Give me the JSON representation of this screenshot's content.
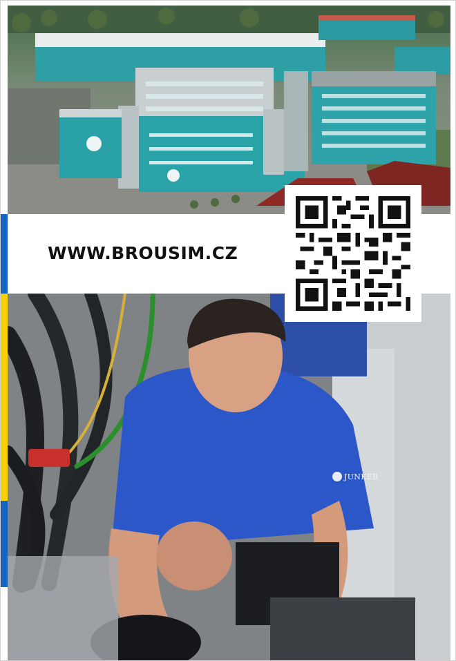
{
  "banner": {
    "url": "WWW.BROUSIM.CZ"
  },
  "shirt": {
    "brand": "JUNKER"
  },
  "icons": {
    "qr": "qr-code-icon",
    "building_logo": "junker-logo-icon"
  },
  "colors": {
    "building_teal": "#2aa3a8",
    "strip_blue": "#1565c0",
    "strip_yellow": "#f6d000",
    "shirt_blue": "#2b57c8"
  }
}
